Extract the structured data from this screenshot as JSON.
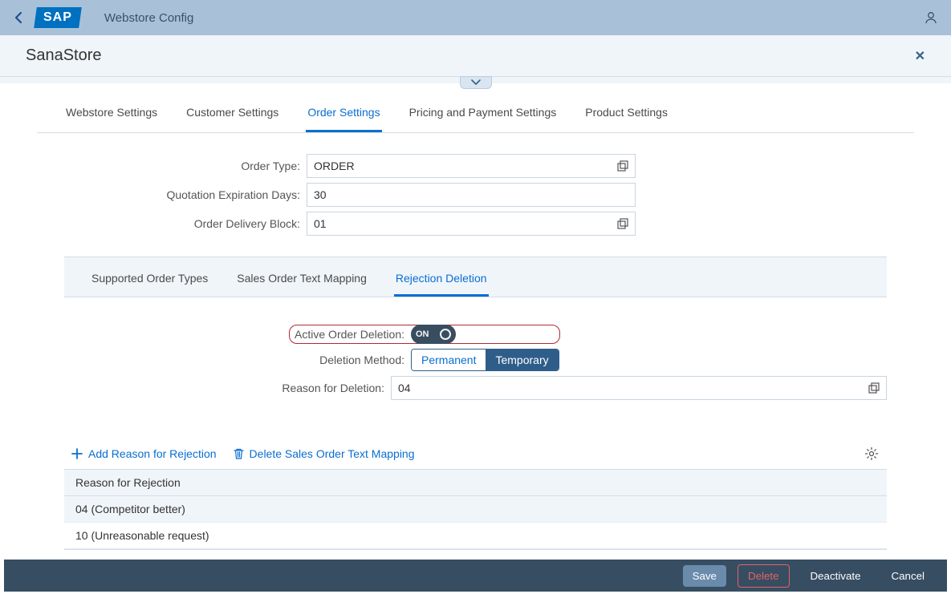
{
  "header": {
    "app_title": "Webstore Config"
  },
  "subheader": {
    "title": "SanaStore"
  },
  "main_tabs": {
    "t0": "Webstore Settings",
    "t1": "Customer Settings",
    "t2": "Order Settings",
    "t3": "Pricing and Payment Settings",
    "t4": "Product Settings"
  },
  "form": {
    "order_type_label": "Order Type:",
    "order_type_value": "ORDER",
    "quotation_label": "Quotation Expiration Days:",
    "quotation_value": "30",
    "delivery_block_label": "Order Delivery Block:",
    "delivery_block_value": "01"
  },
  "sub_tabs": {
    "s0": "Supported Order Types",
    "s1": "Sales Order Text Mapping",
    "s2": "Rejection Deletion"
  },
  "rejection": {
    "active_label": "Active Order Deletion:",
    "toggle_on": "ON",
    "method_label": "Deletion Method:",
    "method_permanent": "Permanent",
    "method_temporary": "Temporary",
    "reason_label": "Reason for Deletion:",
    "reason_value": "04"
  },
  "toolbar": {
    "add": "Add Reason for Rejection",
    "del": "Delete Sales Order Text Mapping"
  },
  "table": {
    "col": "Reason for Rejection",
    "row0": "04 (Competitor better)",
    "row1": "10 (Unreasonable request)"
  },
  "footer": {
    "save": "Save",
    "delete": "Delete",
    "deactivate": "Deactivate",
    "cancel": "Cancel"
  }
}
